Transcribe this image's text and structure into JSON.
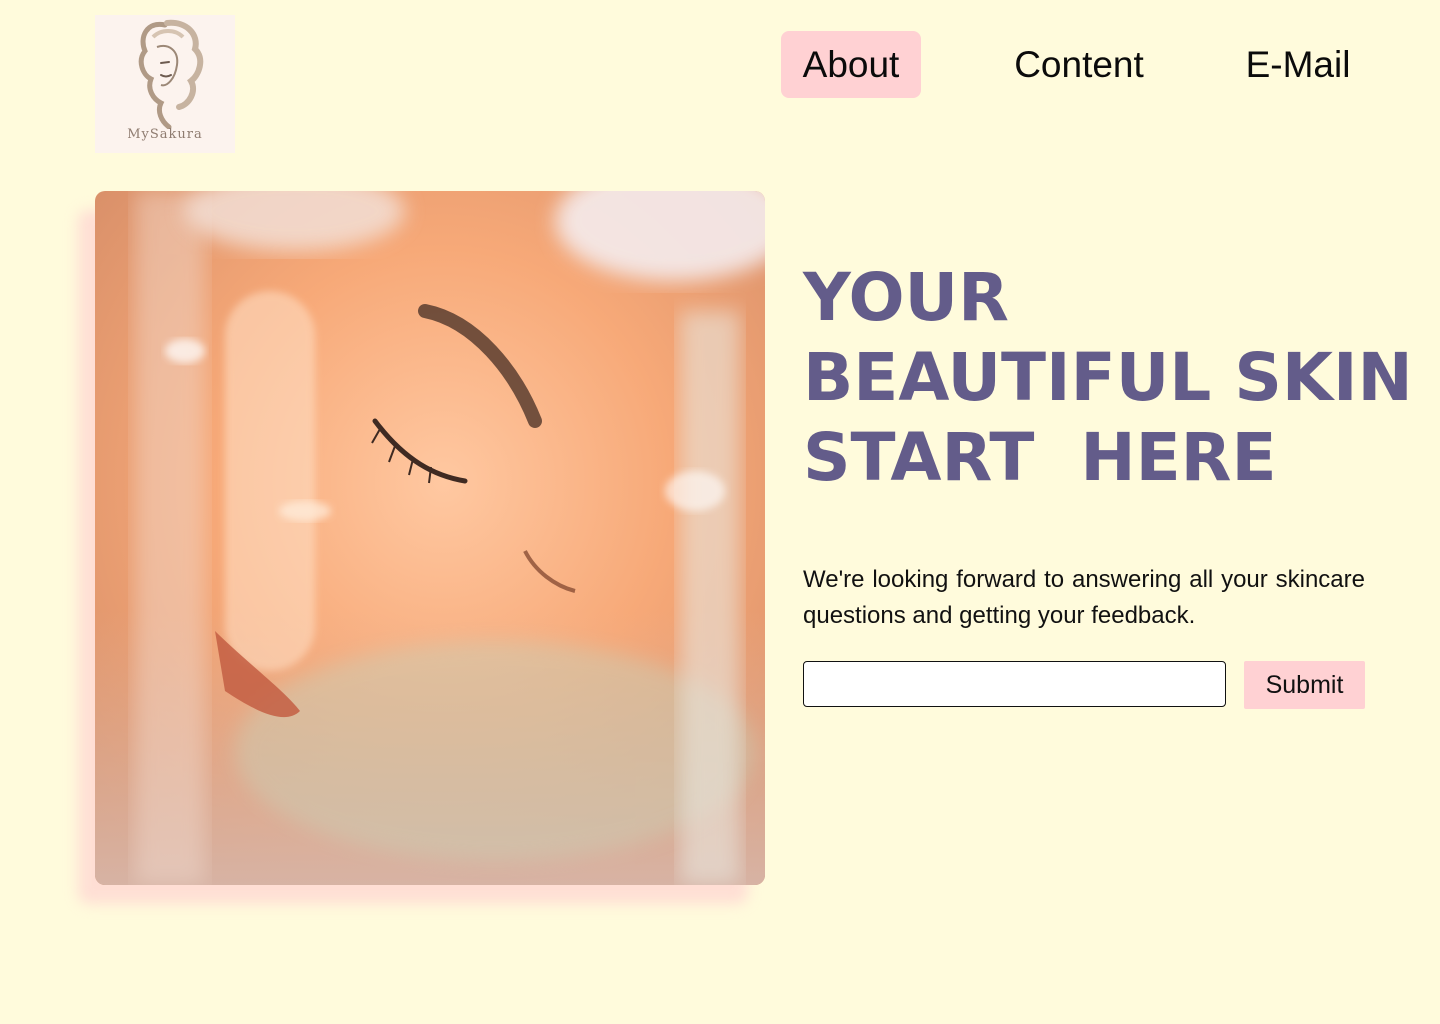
{
  "brand": {
    "logo_text": "MySakura",
    "logo_bg": "#fcf3ee"
  },
  "nav": {
    "items": [
      {
        "label": "About",
        "active": true
      },
      {
        "label": "Content",
        "active": false
      },
      {
        "label": "E-Mail",
        "active": false
      }
    ]
  },
  "hero": {
    "image_icon": "face-portrait-photo",
    "headline": [
      "YOUR",
      "BEAUTIFUL SKIN",
      "START  HERE"
    ],
    "description": "We're looking forward to answering all your skincare questions and getting your feedback.",
    "form": {
      "email_value": "",
      "email_placeholder": "",
      "submit_label": "Submit"
    }
  },
  "colors": {
    "background": "#fffbdc",
    "accent_pink": "#ffd1d3",
    "headline": "#635c8a"
  }
}
